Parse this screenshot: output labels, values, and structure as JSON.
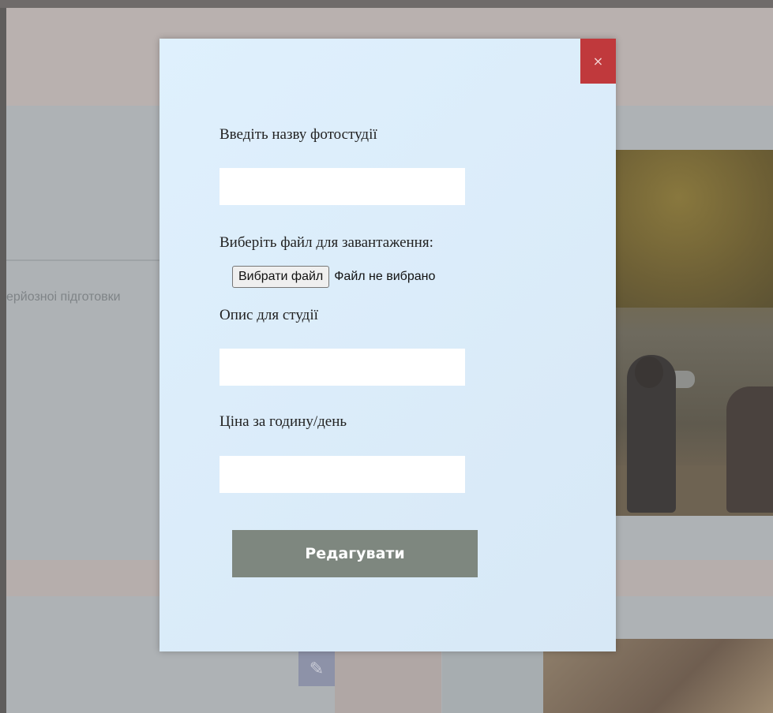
{
  "background": {
    "snippet_text": "ерйозноі підготовки",
    "edit_icon": "pencil-icon"
  },
  "modal": {
    "close_label": "×",
    "studio_name_label": "Введіть назву фотостудії",
    "studio_name_value": "",
    "file_label": "Виберіть файл для завантаження:",
    "file_button_label": "Вибрати файл",
    "file_status": "Файл не вибрано",
    "description_label": "Опис для студії",
    "description_value": "",
    "price_label": "Ціна за годину/день",
    "price_value": "",
    "submit_label": "Редагувати"
  },
  "colors": {
    "close_button": "#c0393c",
    "submit_button": "#7e877f",
    "modal_background": "#dcedfb"
  }
}
